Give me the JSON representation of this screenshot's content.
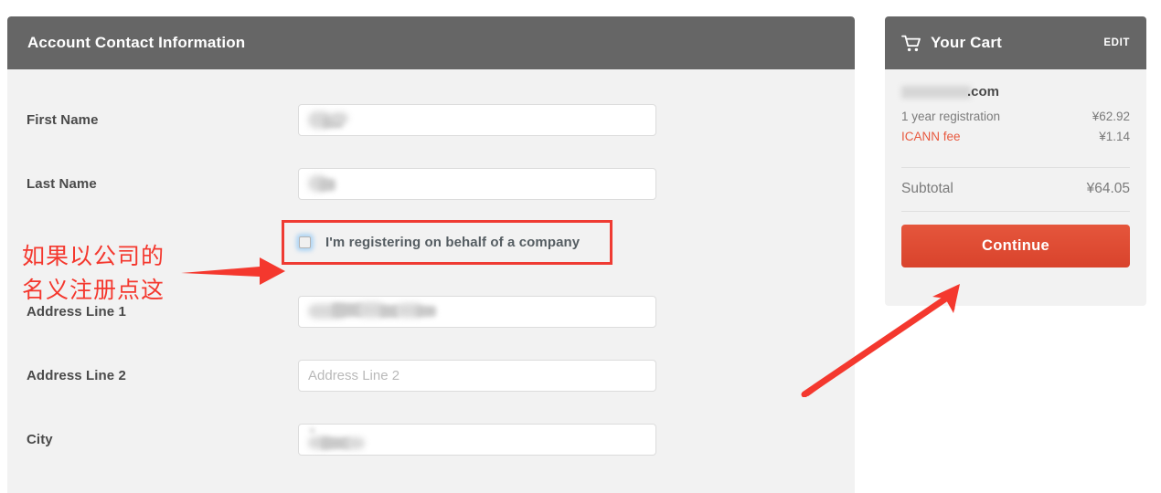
{
  "form": {
    "title": "Account Contact Information",
    "rows": [
      {
        "label": "First Name",
        "value": "",
        "placeholder": "",
        "redacted": true
      },
      {
        "label": "Last Name",
        "value": "",
        "placeholder": "",
        "redacted": true
      },
      {
        "label": "Address Line 1",
        "value": "",
        "placeholder": "",
        "redacted": true
      },
      {
        "label": "Address Line 2",
        "value": "",
        "placeholder": "Address Line 2",
        "redacted": false
      },
      {
        "label": "City",
        "value": "",
        "placeholder": "",
        "redacted": true
      }
    ],
    "checkbox": {
      "label": "I'm registering on behalf of a company",
      "checked": false,
      "highlight_color": "#ef3b33"
    }
  },
  "annotation": {
    "text": "如果以公司的\n名义注册点这",
    "color": "#f4382e"
  },
  "cart": {
    "title": "Your Cart",
    "icon": "shopping-cart-icon",
    "edit_label": "EDIT",
    "domain_tld": ".com",
    "items": [
      {
        "label": "1 year registration",
        "price": "¥62.92",
        "accent": false
      },
      {
        "label": "ICANN fee",
        "price": "¥1.14",
        "accent": true
      }
    ],
    "subtotal_label": "Subtotal",
    "subtotal_value": "¥64.05",
    "continue_label": "Continue",
    "accent_color": "#e8593f",
    "button_color": "#de4a31"
  }
}
